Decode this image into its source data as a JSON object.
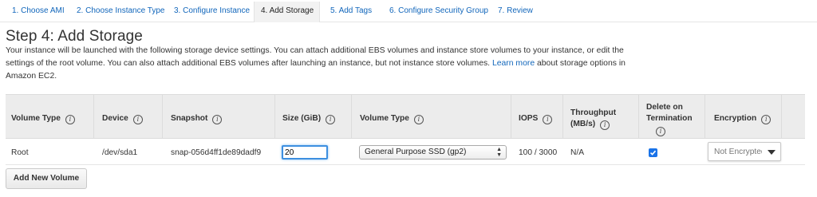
{
  "wizard": {
    "tabs": [
      "1. Choose AMI",
      "2. Choose Instance Type",
      "3. Configure Instance",
      "4. Add Storage",
      "5. Add Tags",
      "6. Configure Security Group",
      "7. Review"
    ],
    "active_index": 3
  },
  "page": {
    "title": "Step 4: Add Storage",
    "description": "Your instance will be launched with the following storage device settings. You can attach additional EBS volumes and instance store volumes to your instance, or edit the settings of the root volume. You can also attach additional EBS volumes after launching an instance, but not instance store volumes.",
    "learn_more": "Learn more",
    "description_tail": "about storage options in Amazon EC2."
  },
  "table": {
    "headers": {
      "volume_type": "Volume Type",
      "device": "Device",
      "snapshot": "Snapshot",
      "size": "Size (GiB)",
      "volume_type_2": "Volume Type",
      "iops": "IOPS",
      "throughput_1": "Throughput",
      "throughput_2": "(MB/s)",
      "delete_1": "Delete on",
      "delete_2": "Termination",
      "encryption": "Encryption"
    },
    "info_glyph": "i",
    "row": {
      "volume_type": "Root",
      "device": "/dev/sda1",
      "snapshot": "snap-056d4ff1de89dadf9",
      "size": "20",
      "ebs_type": "General Purpose SSD (gp2)",
      "iops": "100 / 3000",
      "throughput": "N/A",
      "delete_on_termination": true,
      "encryption": "Not Encrypted"
    }
  },
  "actions": {
    "add_volume": "Add New Volume"
  },
  "colors": {
    "link": "#1166bb",
    "accent": "#1a73e8",
    "header_bg": "#ececec"
  }
}
